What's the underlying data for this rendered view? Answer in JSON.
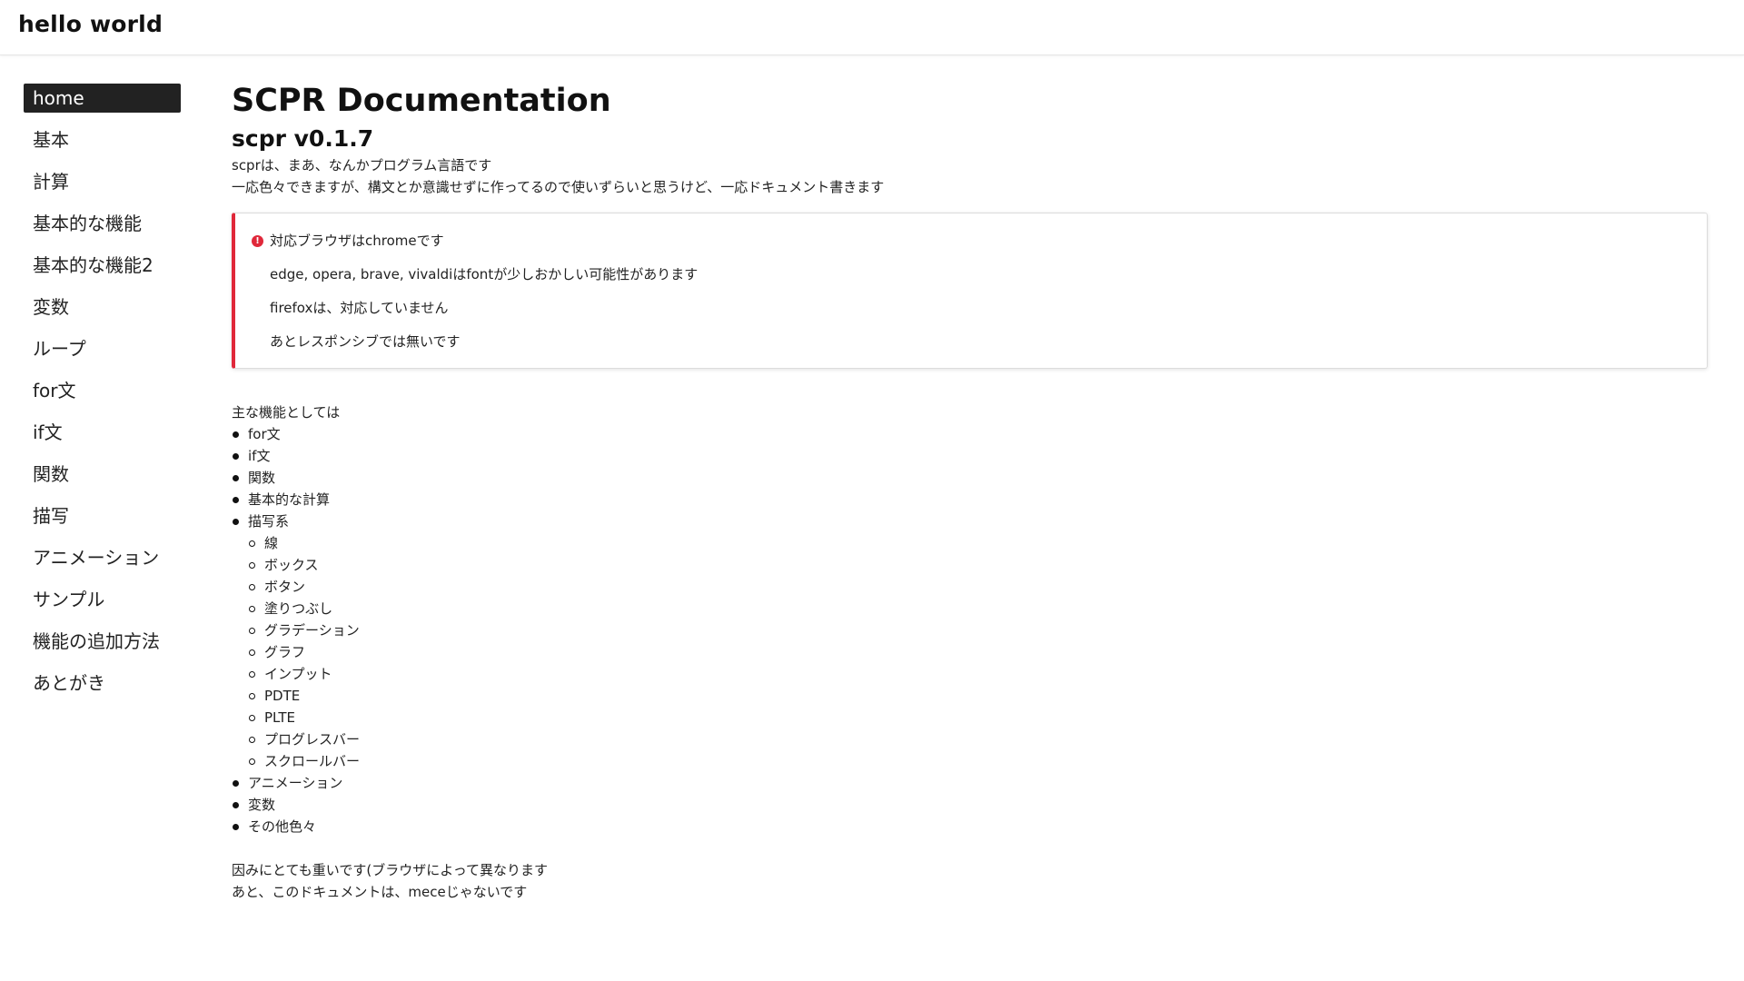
{
  "header": {
    "site_title": "hello world",
    "accent_color": "#f2c200"
  },
  "sidebar": {
    "items": [
      {
        "label": "home",
        "active": true
      },
      {
        "label": "基本"
      },
      {
        "label": "計算"
      },
      {
        "label": "基本的な機能"
      },
      {
        "label": "基本的な機能2"
      },
      {
        "label": "変数"
      },
      {
        "label": "ループ"
      },
      {
        "label": "for文"
      },
      {
        "label": "if文"
      },
      {
        "label": "関数"
      },
      {
        "label": "描写"
      },
      {
        "label": "アニメーション"
      },
      {
        "label": "サンプル"
      },
      {
        "label": "機能の追加方法"
      },
      {
        "label": "あとがき"
      }
    ]
  },
  "main": {
    "title": "SCPR Documentation",
    "version": "scpr v0.1.7",
    "intro": [
      "scprは、まあ、なんかプログラム言語です",
      "一応色々できますが、構文とか意識せずに作ってるので使いずらいと思うけど、一応ドキュメント書きます"
    ],
    "notice": {
      "icon": "alert-circle-icon",
      "accent_color": "#e0283a",
      "lines": [
        "対応ブラウザはchromeです",
        "edge, opera, brave, vivaldiはfontが少しおかしい可能性があります",
        "firefoxは、対応していません",
        "あとレスポンシブでは無いです"
      ]
    },
    "features": {
      "lead": "主な機能としては",
      "items": [
        "for文",
        "if文",
        "関数",
        "基本的な計算",
        "描写系"
      ],
      "sub_items": [
        "線",
        "ボックス",
        "ボタン",
        "塗りつぶし",
        "グラデーション",
        "グラフ",
        "インプット",
        "PDTE",
        "PLTE",
        "プログレスバー",
        "スクロールバー"
      ],
      "more_items": [
        "アニメーション",
        "変数",
        "その他色々"
      ]
    },
    "footer_notes": [
      "因みにとても重いです(ブラウザによって異なります",
      "あと、このドキュメントは、meceじゃないです"
    ]
  }
}
